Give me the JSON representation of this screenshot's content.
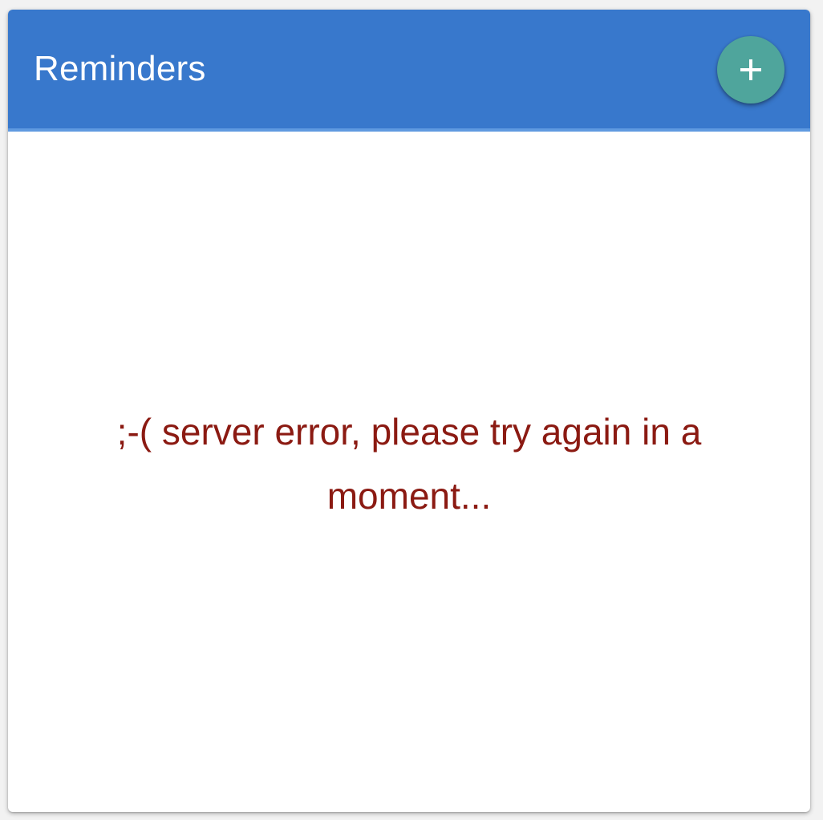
{
  "header": {
    "title": "Reminders",
    "add_button_icon": "plus-icon",
    "color": "#3878cc",
    "fab_color": "#4fa59c"
  },
  "main": {
    "error_message": ";-( server error, please try again in a moment...",
    "error_color": "#8b1a12"
  }
}
